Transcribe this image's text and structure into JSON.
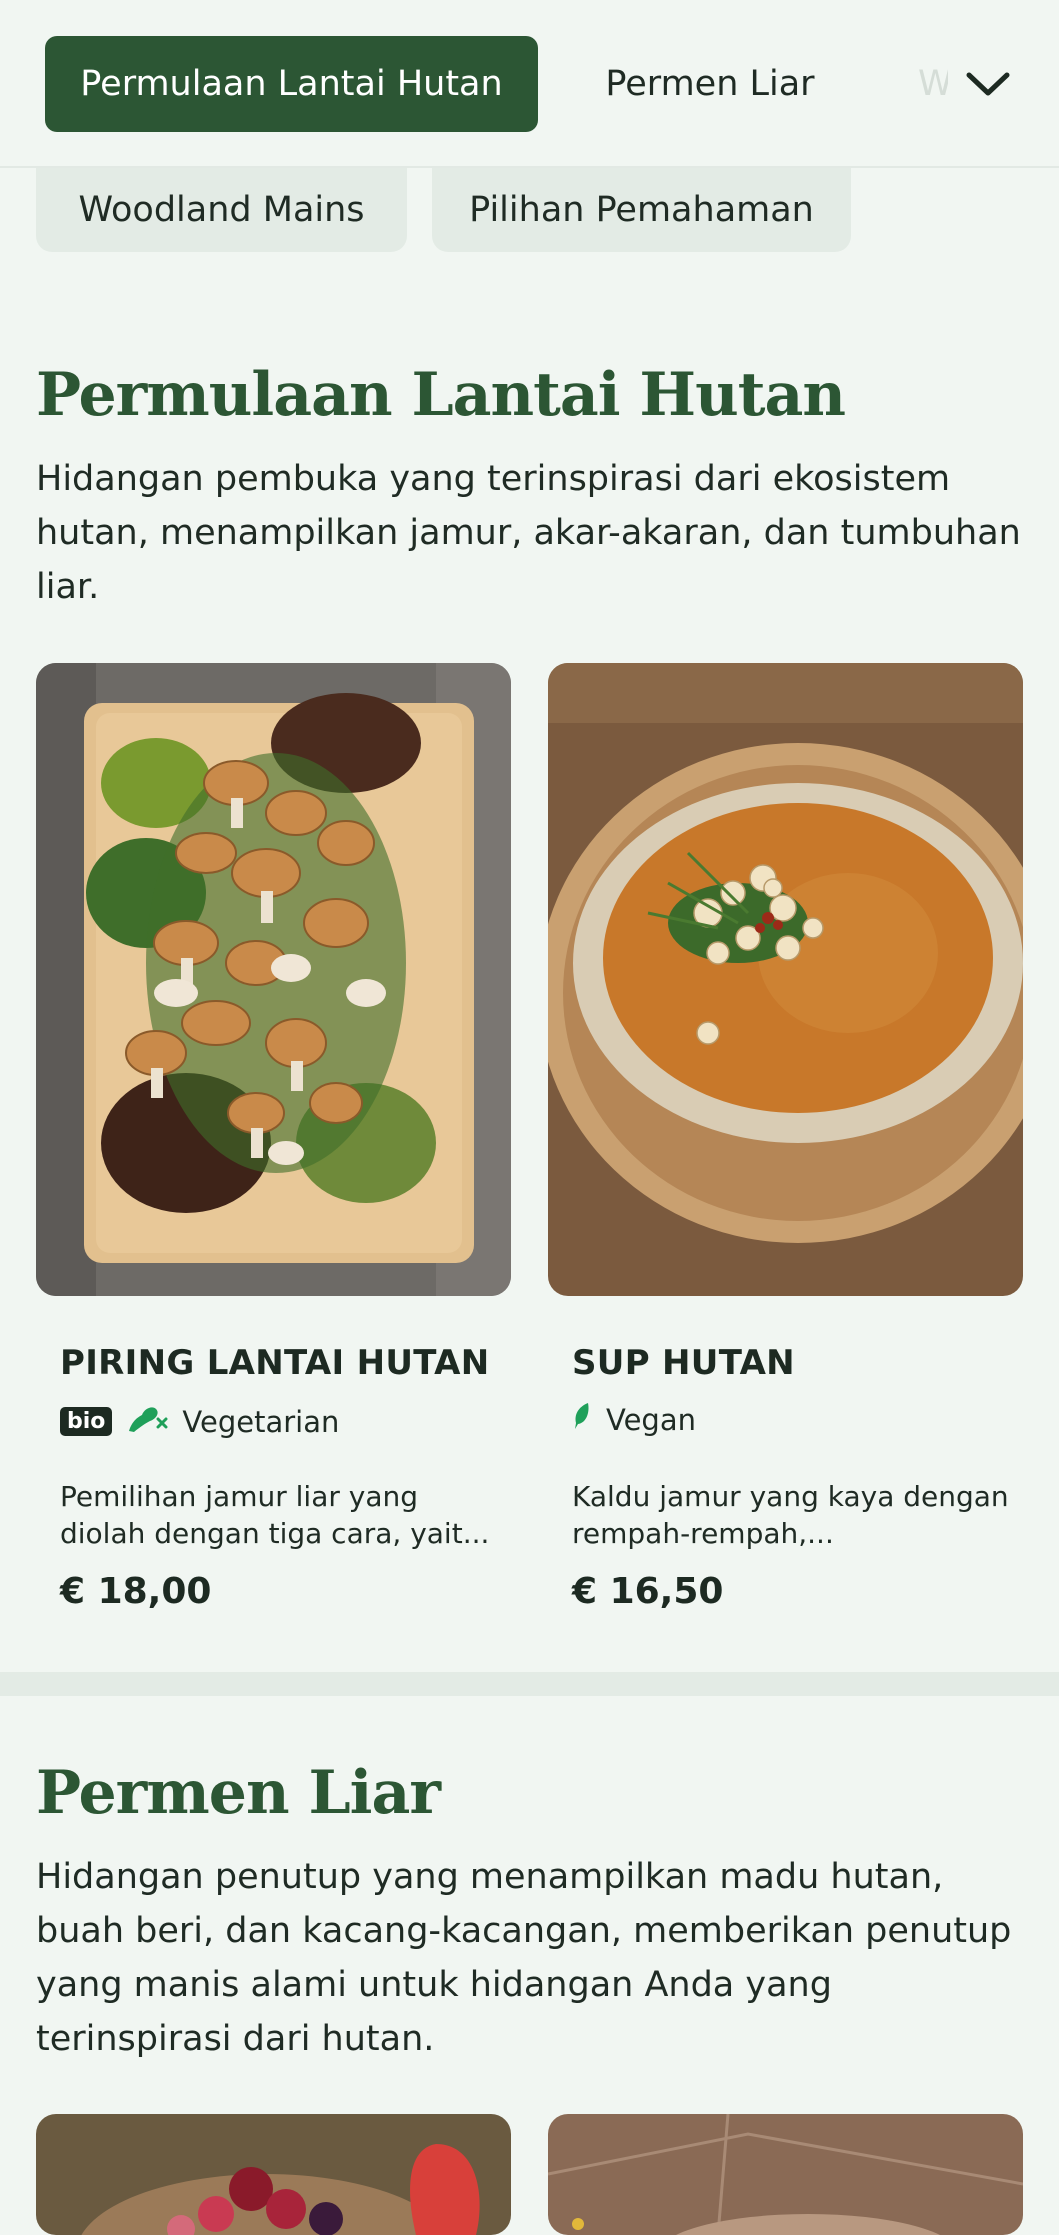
{
  "nav": {
    "active_tab": "Permulaan Lantai Hutan",
    "tab_2": "Permen Liar",
    "tab_3_partial": "W",
    "chips": [
      "Woodland Mains",
      "Pilihan Pemahaman"
    ]
  },
  "sections": [
    {
      "title": "Permulaan Lantai Hutan",
      "description": "Hidangan pembuka yang terinspirasi dari ekosistem hutan, menampilkan jamur, akar-akaran, dan tumbuhan liar.",
      "items": [
        {
          "name": "PIRING LANTAI HUTAN",
          "badge": "bio",
          "diet": "Vegetarian",
          "description": "Pemilihan jamur liar yang diolah dengan tiga cara, yait...",
          "price": "€ 18,00"
        },
        {
          "name": "SUP HUTAN",
          "diet": "Vegan",
          "description": "Kaldu jamur yang kaya dengan rempah-rempah,...",
          "price": "€ 16,50"
        }
      ]
    },
    {
      "title": "Permen Liar",
      "description": "Hidangan penutup yang menampilkan madu hutan, buah beri, dan kacang-kacangan, memberikan penutup yang manis alami untuk hidangan Anda yang terinspirasi dari hutan."
    }
  ],
  "colors": {
    "accent": "#2c5634",
    "background": "#f1f6f2",
    "chip": "#e3ebe5",
    "vegan_green": "#1fa05a"
  },
  "icons": [
    "chevron-down-icon",
    "no-meat-icon",
    "leaf-icon"
  ]
}
